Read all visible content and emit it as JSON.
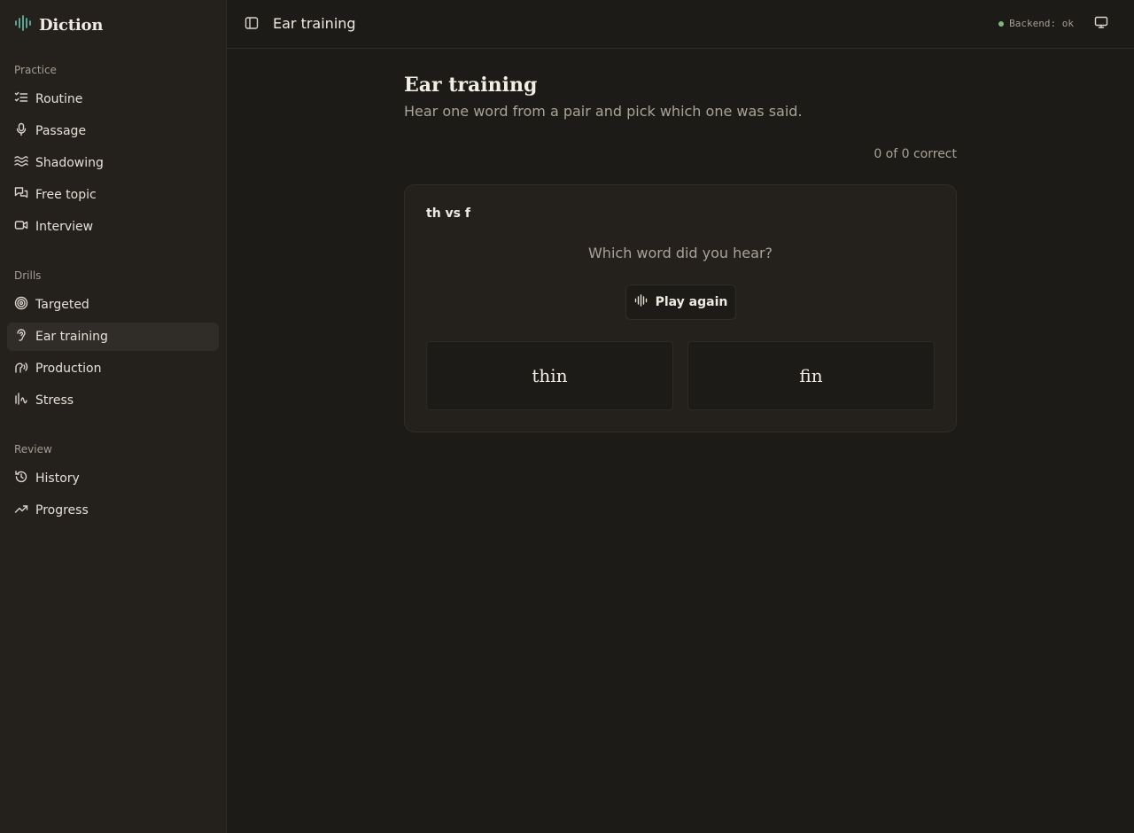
{
  "app": {
    "name": "Diction"
  },
  "sidebar": {
    "groups": [
      {
        "label": "Practice",
        "items": [
          {
            "label": "Routine",
            "icon": "list-checks-icon"
          },
          {
            "label": "Passage",
            "icon": "microphone-icon"
          },
          {
            "label": "Shadowing",
            "icon": "waves-icon"
          },
          {
            "label": "Free topic",
            "icon": "chat-bubbles-icon"
          },
          {
            "label": "Interview",
            "icon": "video-camera-icon"
          }
        ]
      },
      {
        "label": "Drills",
        "items": [
          {
            "label": "Targeted",
            "icon": "target-icon"
          },
          {
            "label": "Ear training",
            "icon": "ear-icon",
            "active": true
          },
          {
            "label": "Production",
            "icon": "speech-icon"
          },
          {
            "label": "Stress",
            "icon": "activity-icon"
          }
        ]
      },
      {
        "label": "Review",
        "items": [
          {
            "label": "History",
            "icon": "history-icon"
          },
          {
            "label": "Progress",
            "icon": "trending-up-icon"
          }
        ]
      }
    ]
  },
  "header": {
    "title": "Ear training",
    "backend_status": "Backend: ok",
    "status_color": "#7fb77e"
  },
  "main": {
    "title": "Ear training",
    "subtitle": "Hear one word from a pair and pick which one was said.",
    "score": "0 of 0 correct",
    "card": {
      "pair_label": "th vs f",
      "question": "Which word did you hear?",
      "play_label": "Play again",
      "choices": [
        "thin",
        "fin"
      ]
    }
  },
  "colors": {
    "background": "#1d1b18",
    "sidebar": "#24211d",
    "accent": "#5fb3a0"
  }
}
